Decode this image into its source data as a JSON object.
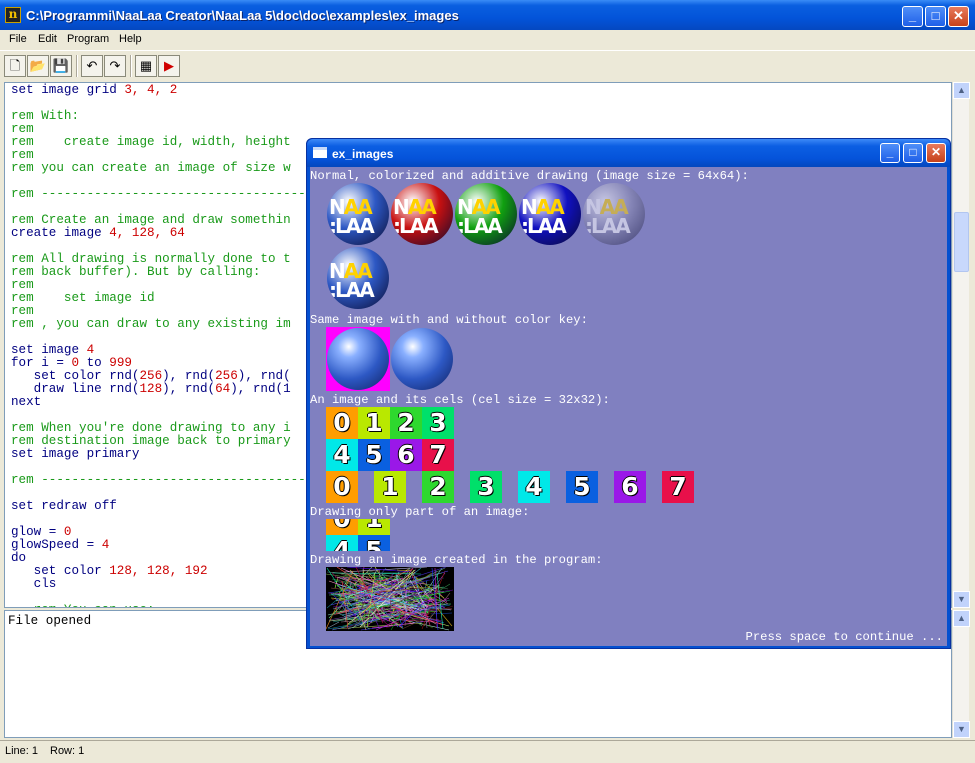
{
  "window": {
    "title": "C:\\Programmi\\NaaLaa Creator\\NaaLaa 5\\doc\\doc\\examples\\ex_images",
    "app_icon": "n",
    "minimize": "_",
    "maximize": "□",
    "close": "✕"
  },
  "menu": [
    "File",
    "Edit",
    "Program",
    "Help"
  ],
  "toolbar": {
    "new": "🗋",
    "open": "📂",
    "save": "💾",
    "undo": "↶",
    "redo": "↷",
    "compile": "▦",
    "run": "▶"
  },
  "editor": {
    "lines": [
      {
        "t": "set image grid ",
        "n": "3, 4, 2"
      },
      {
        "t": ""
      },
      {
        "t": "rem With:",
        "rem": true
      },
      {
        "t": "rem",
        "rem": true
      },
      {
        "t": "rem    create image id, width, height",
        "rem": true
      },
      {
        "t": "rem",
        "rem": true
      },
      {
        "t": "rem you can create an image of size w",
        "rem": true
      },
      {
        "t": ""
      },
      {
        "t": "rem -----------------------------------",
        "rem": true
      },
      {
        "t": ""
      },
      {
        "t": "rem Create an image and draw somethin",
        "rem": true
      },
      {
        "t": "create image ",
        "n": "4, 128, 64"
      },
      {
        "t": ""
      },
      {
        "t": "rem All drawing is normally done to t",
        "rem": true
      },
      {
        "t": "rem back buffer). But by calling:",
        "rem": true
      },
      {
        "t": "rem",
        "rem": true
      },
      {
        "t": "rem    set image id",
        "rem": true
      },
      {
        "t": "rem",
        "rem": true
      },
      {
        "t": "rem , you can draw to any existing im",
        "rem": true
      },
      {
        "t": ""
      },
      {
        "t": "set image ",
        "n": "4"
      },
      {
        "t": "for i = ",
        "n": "0",
        "t2": " to ",
        "n2": "999"
      },
      {
        "t": "   set color rnd(",
        "n": "256",
        "t2": "), rnd(",
        "n2": "256",
        "t3": "), rnd("
      },
      {
        "t": "   draw line rnd(",
        "n": "128",
        "t2": "), rnd(",
        "n2": "64",
        "t3": "), rnd(1"
      },
      {
        "t": "next"
      },
      {
        "t": ""
      },
      {
        "t": "rem When you're done drawing to any i",
        "rem": true
      },
      {
        "t": "rem destination image back to primary",
        "rem": true
      },
      {
        "t": "set image primary"
      },
      {
        "t": ""
      },
      {
        "t": "rem -----------------------------------",
        "rem": true
      },
      {
        "t": ""
      },
      {
        "t": "set redraw off"
      },
      {
        "t": ""
      },
      {
        "t": "glow = ",
        "n": "0"
      },
      {
        "t": "glowSpeed = ",
        "n": "4"
      },
      {
        "t": "do"
      },
      {
        "t": "   set color ",
        "n": "128, 128, 192"
      },
      {
        "t": "   cls"
      },
      {
        "t": ""
      },
      {
        "t": "   rem You can use:",
        "rem": true
      }
    ]
  },
  "output": {
    "text": "File opened"
  },
  "status": {
    "line": "Line: 1",
    "row": "Row: 1"
  },
  "child": {
    "title": "ex_images",
    "minimize": "_",
    "maximize": "□",
    "close": "✕",
    "labels": {
      "normal": "Normal, colorized and additive drawing (image size = 64x64):",
      "colorkey": "Same image with and without color key:",
      "cels": "An image and its cels (cel size = 32x32):",
      "part": "Drawing only part of an image:",
      "created": "Drawing an image created in the program:",
      "press": "Press space to continue ..."
    },
    "logo": {
      "top": "NAA",
      "bottom": ":LAA"
    },
    "cels": [
      "0",
      "1",
      "2",
      "3",
      "4",
      "5",
      "6",
      "7"
    ],
    "cel_colors": [
      "#ff9d00",
      "#b9e800",
      "#2ed82e",
      "#00e06a",
      "#00e8e8",
      "#0a60e0",
      "#9a18e8",
      "#e8104a"
    ],
    "ball_tints": [
      "#2d58c4",
      "#c81010",
      "#10a010",
      "#1010c0",
      "#8a8ab0"
    ]
  }
}
